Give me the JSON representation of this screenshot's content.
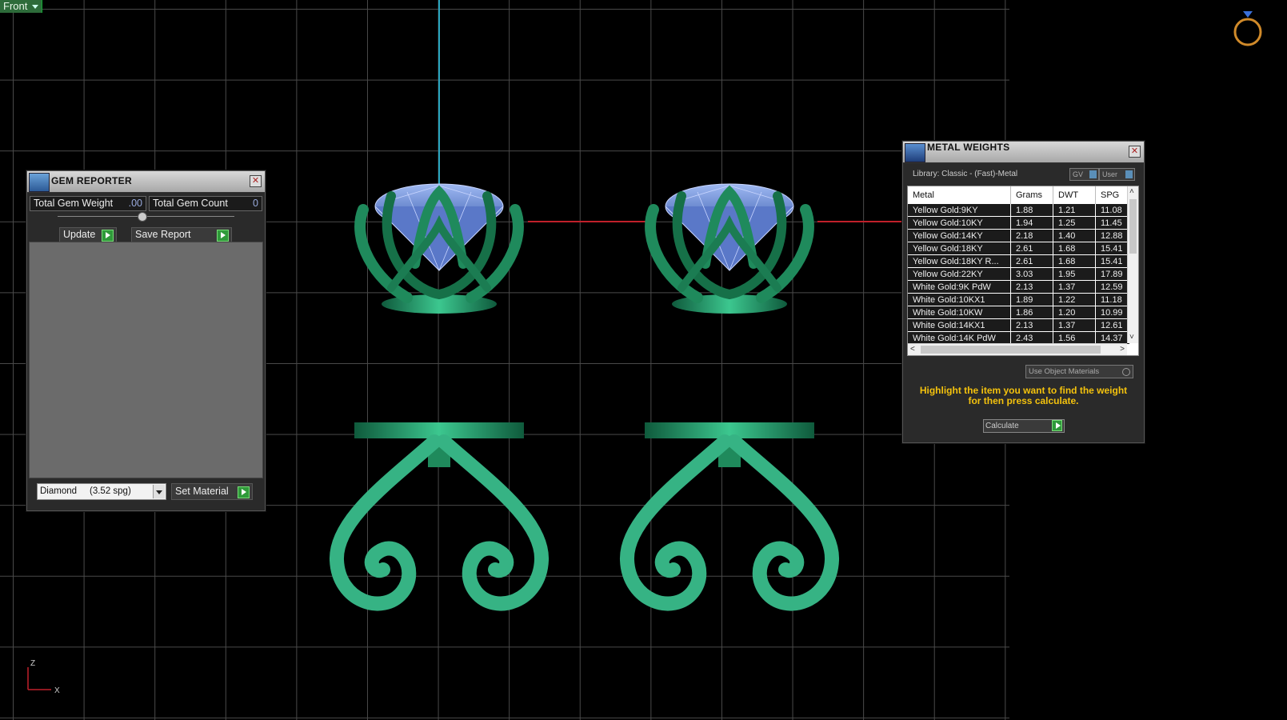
{
  "viewport": {
    "label": "Front"
  },
  "axis": {
    "z": "Z",
    "x": "X"
  },
  "gem_reporter": {
    "title": "GEM REPORTER",
    "total_weight_label": "Total Gem Weight",
    "total_weight_value": ".00",
    "total_count_label": "Total Gem Count",
    "total_count_value": "0",
    "update_label": "Update",
    "save_report_label": "Save Report",
    "material_selected": "Diamond     (3.52 spg)",
    "set_material_label": "Set Material"
  },
  "metal_weights": {
    "title": "METAL WEIGHTS",
    "library": "Library: Classic - (Fast)-Metal",
    "toggle_gv": "GV",
    "toggle_user": "User",
    "columns": [
      "Metal",
      "Grams",
      "DWT",
      "SPG"
    ],
    "rows": [
      {
        "metal": "Yellow Gold:9KY",
        "grams": "1.88",
        "dwt": "1.21",
        "spg": "11.08"
      },
      {
        "metal": "Yellow Gold:10KY",
        "grams": "1.94",
        "dwt": "1.25",
        "spg": "11.45"
      },
      {
        "metal": "Yellow Gold:14KY",
        "grams": "2.18",
        "dwt": "1.40",
        "spg": "12.88"
      },
      {
        "metal": "Yellow Gold:18KY",
        "grams": "2.61",
        "dwt": "1.68",
        "spg": "15.41"
      },
      {
        "metal": "Yellow Gold:18KY R...",
        "grams": "2.61",
        "dwt": "1.68",
        "spg": "15.41"
      },
      {
        "metal": "Yellow Gold:22KY",
        "grams": "3.03",
        "dwt": "1.95",
        "spg": "17.89"
      },
      {
        "metal": "White Gold:9K PdW",
        "grams": "2.13",
        "dwt": "1.37",
        "spg": "12.59"
      },
      {
        "metal": "White Gold:10KX1",
        "grams": "1.89",
        "dwt": "1.22",
        "spg": "11.18"
      },
      {
        "metal": "White Gold:10KW",
        "grams": "1.86",
        "dwt": "1.20",
        "spg": "10.99"
      },
      {
        "metal": "White Gold:14KX1",
        "grams": "2.13",
        "dwt": "1.37",
        "spg": "12.61"
      },
      {
        "metal": "White Gold:14K PdW",
        "grams": "2.43",
        "dwt": "1.56",
        "spg": "14.37"
      }
    ],
    "use_object_materials": "Use Object Materials",
    "hint": "Highlight the item you want to find the weight for then press calculate.",
    "calculate_label": "Calculate"
  },
  "colors": {
    "metal": "#1f8a5c",
    "metal_light": "#3fc38e",
    "gem": "#7f9fe6",
    "axis_red": "#c0202a",
    "axis_cyan": "#2aa6c0"
  }
}
